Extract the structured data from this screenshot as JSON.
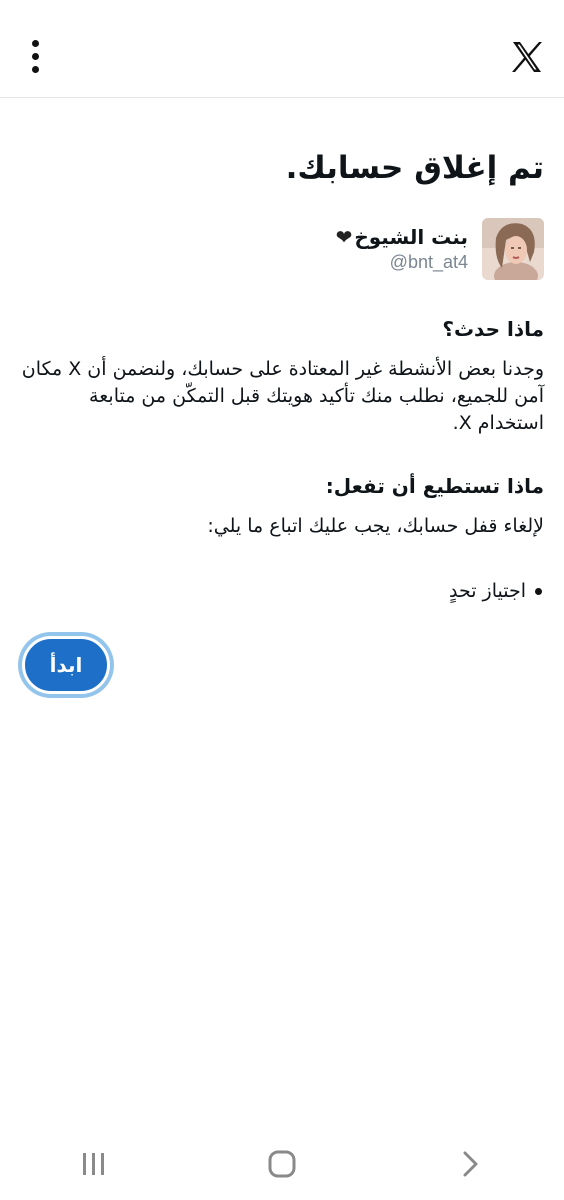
{
  "topbar": {
    "menu_icon": "more-vertical-icon",
    "logo_icon": "x-logo-icon"
  },
  "page": {
    "title": "تم إغلاق حسابك."
  },
  "profile": {
    "display_name": "بنت الشيوخ",
    "heart": "❤",
    "handle": "@bnt_at4"
  },
  "what_happened": {
    "title": "ماذا حدث؟",
    "body": "وجدنا بعض الأنشطة غير المعتادة على حسابك، ولنضمن أن X مكان آمن للجميع، نطلب منك تأكيد هويتك قبل التمكّن من متابعة استخدام X."
  },
  "what_to_do": {
    "title": "ماذا تستطيع أن تفعل:",
    "body": "لإلغاء قفل حسابك، يجب عليك اتباع ما يلي:",
    "steps": [
      "اجتياز تحدٍ"
    ]
  },
  "actions": {
    "start_label": "ابدأ"
  },
  "system_nav": {
    "recents_icon": "recents-icon",
    "home_icon": "home-icon",
    "back_icon": "back-icon"
  }
}
